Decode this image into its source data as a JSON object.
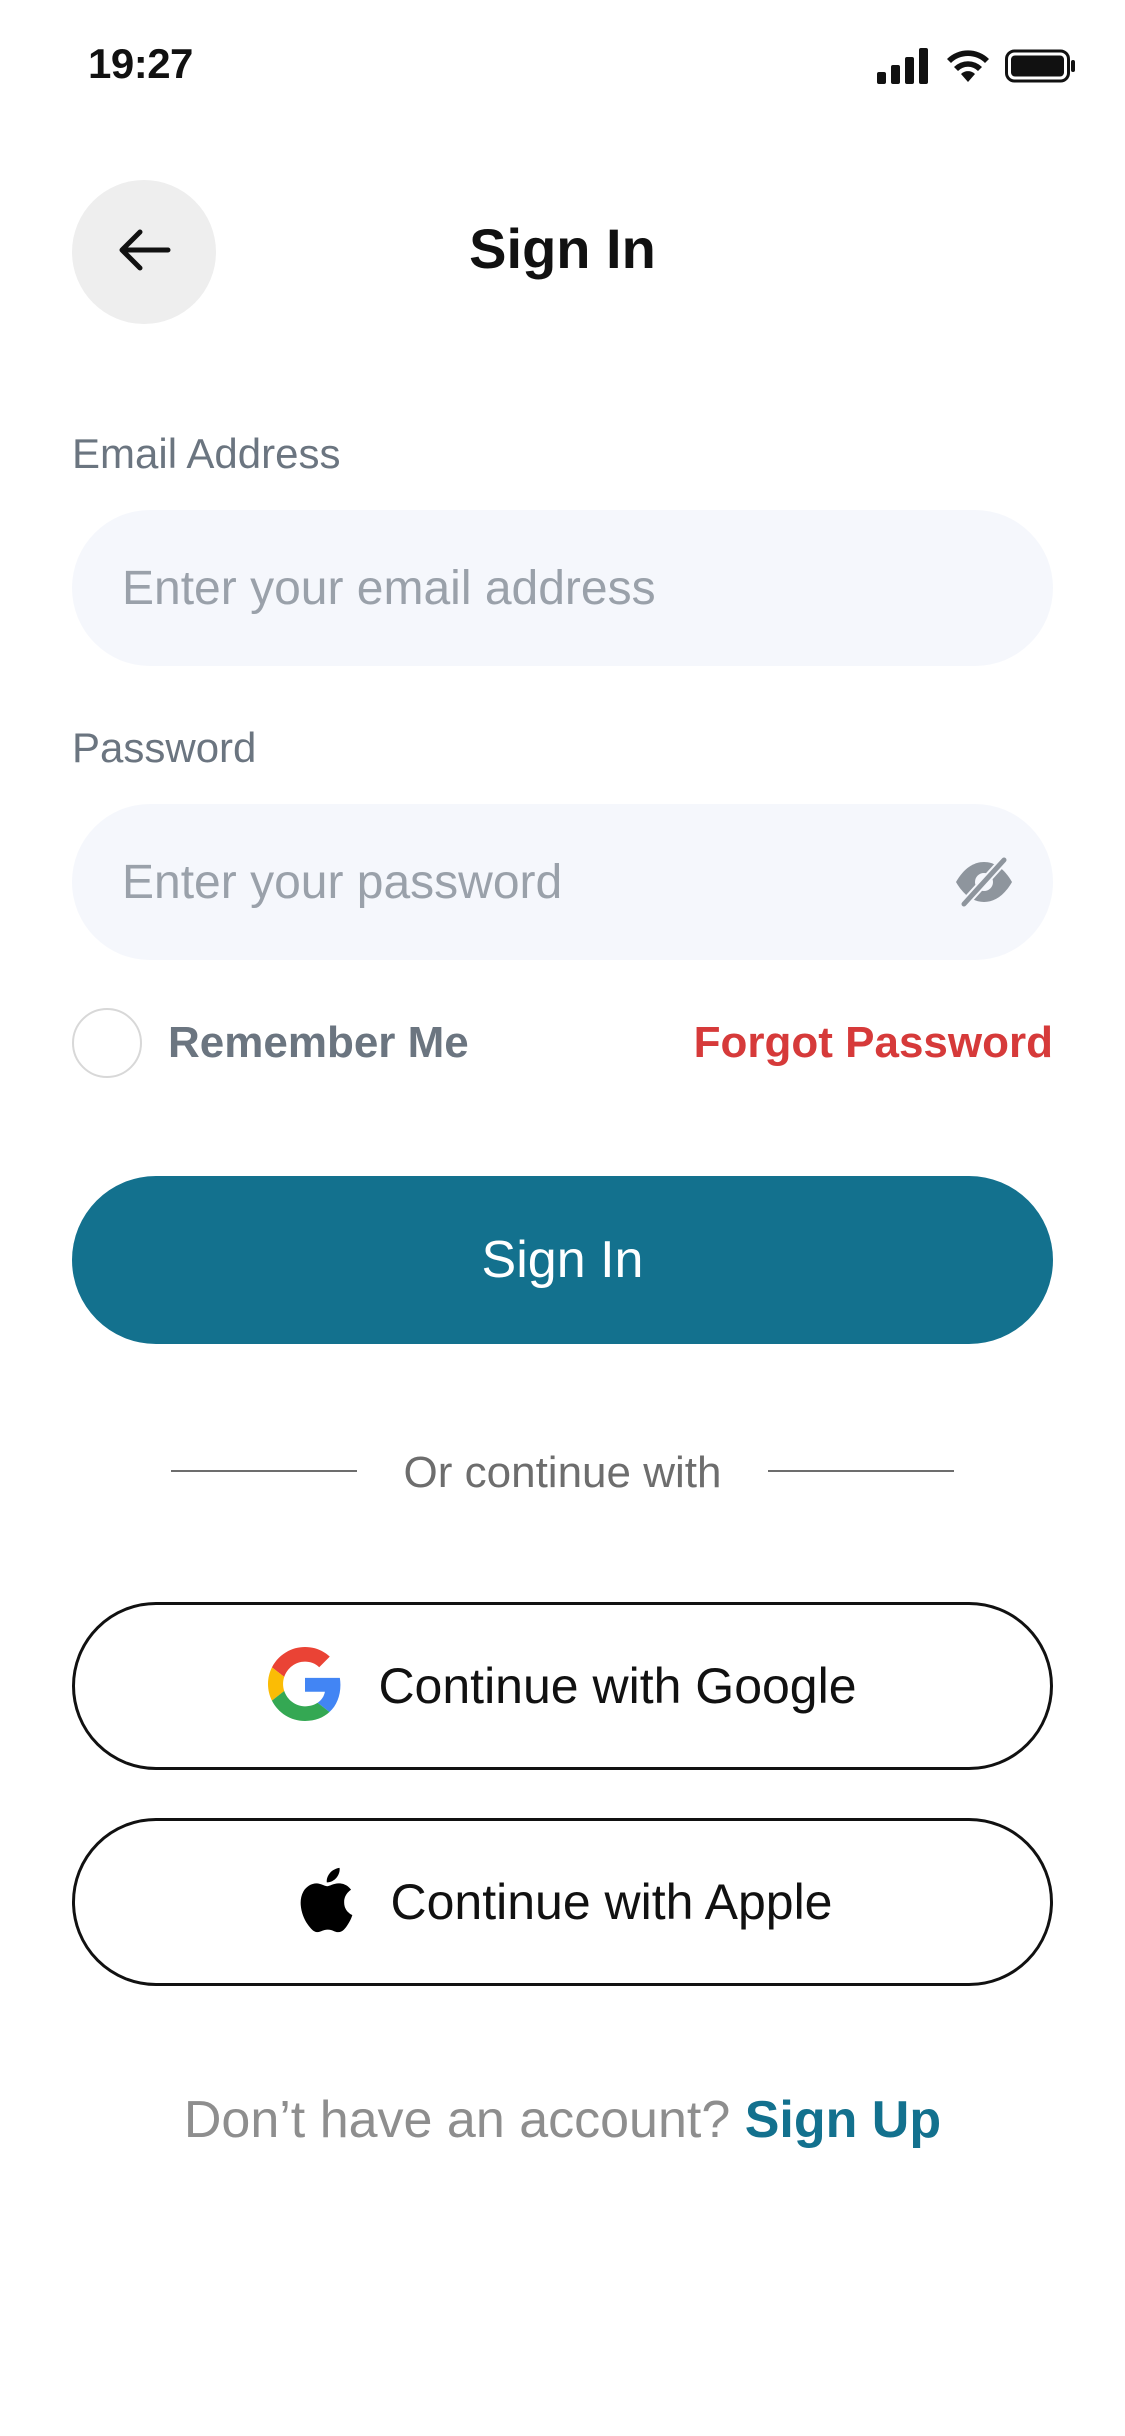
{
  "status_bar": {
    "time": "19:27",
    "icons": [
      "signal-icon",
      "wifi-icon",
      "battery-icon"
    ]
  },
  "header": {
    "title": "Sign In",
    "back_icon": "arrow-left-icon"
  },
  "form": {
    "email": {
      "label": "Email Address",
      "placeholder": "Enter your email address",
      "value": ""
    },
    "password": {
      "label": "Password",
      "placeholder": "Enter your password",
      "value": "",
      "toggle_icon": "eye-off-icon"
    },
    "remember_me": {
      "label": "Remember Me",
      "checked": false
    },
    "forgot_password": "Forgot Password",
    "submit_label": "Sign In"
  },
  "divider_text": "Or continue with",
  "social": {
    "google_label": "Continue with Google",
    "apple_label": "Continue with Apple"
  },
  "footer": {
    "question": "Don’t have an account?",
    "link": "Sign Up"
  },
  "colors": {
    "primary": "#13718e",
    "danger": "#d63a3a",
    "input_bg": "#f5f7fc"
  }
}
